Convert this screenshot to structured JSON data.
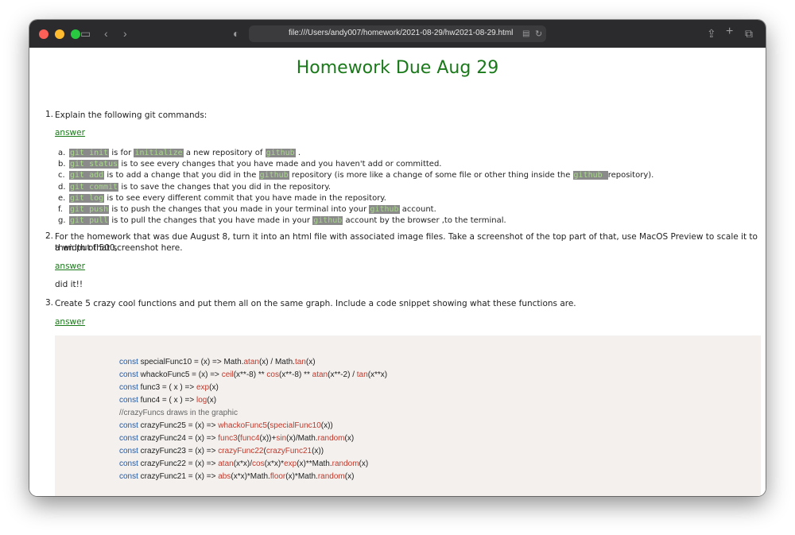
{
  "browser": {
    "url": "file:///Users/andy007/homework/2021-08-29/hw2021-08-29.html"
  },
  "page": {
    "title": "Homework Due Aug 29",
    "q1": {
      "num": "1.",
      "text": "Explain the following git commands:",
      "answer": "answer",
      "items": [
        {
          "letter": "a.",
          "parts": [
            {
              "c": "git init"
            },
            {
              "t": " is for "
            },
            {
              "c": "initialize"
            },
            {
              "t": " a new repository of "
            },
            {
              "c": "github"
            },
            {
              "t": " ."
            }
          ]
        },
        {
          "letter": "b.",
          "parts": [
            {
              "c": "git status"
            },
            {
              "t": " is to see every changes that you have made and you haven't add or committed."
            }
          ]
        },
        {
          "letter": "c.",
          "parts": [
            {
              "c": "git add"
            },
            {
              "t": " is to add a change that you did in the "
            },
            {
              "c": "github"
            },
            {
              "t": " repository (is more like a change of some file or other thing inside the "
            },
            {
              "c": "github "
            },
            {
              "t": " repository)."
            }
          ]
        },
        {
          "letter": "d.",
          "parts": [
            {
              "c": "git commit"
            },
            {
              "t": " is to save the changes that you did in the repository."
            }
          ]
        },
        {
          "letter": "e.",
          "parts": [
            {
              "c": "git log"
            },
            {
              "t": " is to see every different commit that you have made in the repository."
            }
          ]
        },
        {
          "letter": "f.",
          "parts": [
            {
              "c": "git push"
            },
            {
              "t": " is to push the changes that you made in your terminal into your "
            },
            {
              "c": "github"
            },
            {
              "t": " account."
            }
          ]
        },
        {
          "letter": "g.",
          "parts": [
            {
              "c": "git pull"
            },
            {
              "t": " is to pull the changes that you have made in your "
            },
            {
              "c": "github"
            },
            {
              "t": " account by the browser ,to the terminal."
            }
          ]
        }
      ]
    },
    "q2": {
      "num": "2.",
      "text_line1": "For the homework that was due August 8, turn it into an html file with associated image files. Take a screenshot of the top part of that, use MacOS Preview to scale it to a width of 500,",
      "text_line2": "then put that screenshot here.",
      "answer": "answer",
      "response": "did it!!"
    },
    "q3": {
      "num": "3.",
      "text": "Create 5 crazy cool functions and put them all on the same graph. Include a code snippet showing what these functions are.",
      "answer": "answer",
      "code": [
        [
          {
            "k": "kw",
            "t": "const"
          },
          {
            "k": "",
            "t": " specialFunc10 = ("
          },
          {
            "k": "",
            "t": "x"
          },
          {
            "k": "",
            "t": ") => Math."
          },
          {
            "k": "fn",
            "t": "atan"
          },
          {
            "k": "",
            "t": "(x) / Math."
          },
          {
            "k": "fn",
            "t": "tan"
          },
          {
            "k": "",
            "t": "(x)"
          }
        ],
        [
          {
            "k": "kw",
            "t": "const"
          },
          {
            "k": "",
            "t": " whackoFunc5 = (x) => "
          },
          {
            "k": "fn",
            "t": "ceil"
          },
          {
            "k": "",
            "t": "(x**-8) ** "
          },
          {
            "k": "fn",
            "t": "cos"
          },
          {
            "k": "",
            "t": "(x**-8)  ** "
          },
          {
            "k": "fn",
            "t": "atan"
          },
          {
            "k": "",
            "t": "(x**-2) / "
          },
          {
            "k": "fn",
            "t": "tan"
          },
          {
            "k": "",
            "t": "(x**x)"
          }
        ],
        [
          {
            "k": "kw",
            "t": "const"
          },
          {
            "k": "",
            "t": " func3 = ( x )  => "
          },
          {
            "k": "fn",
            "t": "exp"
          },
          {
            "k": "",
            "t": "(x)"
          }
        ],
        [
          {
            "k": "kw",
            "t": "const"
          },
          {
            "k": "",
            "t": " func4 = ( x )  => "
          },
          {
            "k": "fn",
            "t": "log"
          },
          {
            "k": "",
            "t": "(x)"
          }
        ],
        [
          {
            "k": "cm",
            "t": "//crazyFuncs draws in the graphic"
          }
        ],
        [
          {
            "k": "kw",
            "t": "const"
          },
          {
            "k": "",
            "t": " crazyFunc25 = (x) => "
          },
          {
            "k": "fn",
            "t": "whackoFunc5"
          },
          {
            "k": "",
            "t": "("
          },
          {
            "k": "fn",
            "t": "specialFunc10"
          },
          {
            "k": "",
            "t": "(x))"
          }
        ],
        [
          {
            "k": "kw",
            "t": "const"
          },
          {
            "k": "",
            "t": " crazyFunc24 = (x) => "
          },
          {
            "k": "fn",
            "t": "func3"
          },
          {
            "k": "",
            "t": "("
          },
          {
            "k": "fn",
            "t": "func4"
          },
          {
            "k": "",
            "t": "(x))+"
          },
          {
            "k": "fn",
            "t": "sin"
          },
          {
            "k": "",
            "t": "(x)/Math."
          },
          {
            "k": "fn",
            "t": "random"
          },
          {
            "k": "",
            "t": "(x)"
          }
        ],
        [
          {
            "k": "kw",
            "t": "const"
          },
          {
            "k": "",
            "t": " crazyFunc23 = (x) => "
          },
          {
            "k": "fn",
            "t": "crazyFunc22"
          },
          {
            "k": "",
            "t": "("
          },
          {
            "k": "fn",
            "t": "crazyFunc21"
          },
          {
            "k": "",
            "t": "(x))"
          }
        ],
        [
          {
            "k": "kw",
            "t": "const"
          },
          {
            "k": "",
            "t": " crazyFunc22 = (x) => "
          },
          {
            "k": "fn",
            "t": "atan"
          },
          {
            "k": "",
            "t": "(x*x)/"
          },
          {
            "k": "fn",
            "t": "cos"
          },
          {
            "k": "",
            "t": "(x*x)*"
          },
          {
            "k": "fn",
            "t": "exp"
          },
          {
            "k": "",
            "t": "(x)**Math."
          },
          {
            "k": "fn",
            "t": "random"
          },
          {
            "k": "",
            "t": "(x)"
          }
        ],
        [
          {
            "k": "kw",
            "t": "const"
          },
          {
            "k": "",
            "t": " crazyFunc21 = (x) => "
          },
          {
            "k": "fn",
            "t": "abs"
          },
          {
            "k": "",
            "t": "(x*x)*Math."
          },
          {
            "k": "fn",
            "t": "floor"
          },
          {
            "k": "",
            "t": "(x)*Math."
          },
          {
            "k": "fn",
            "t": "random"
          },
          {
            "k": "",
            "t": "(x)"
          }
        ]
      ]
    }
  }
}
